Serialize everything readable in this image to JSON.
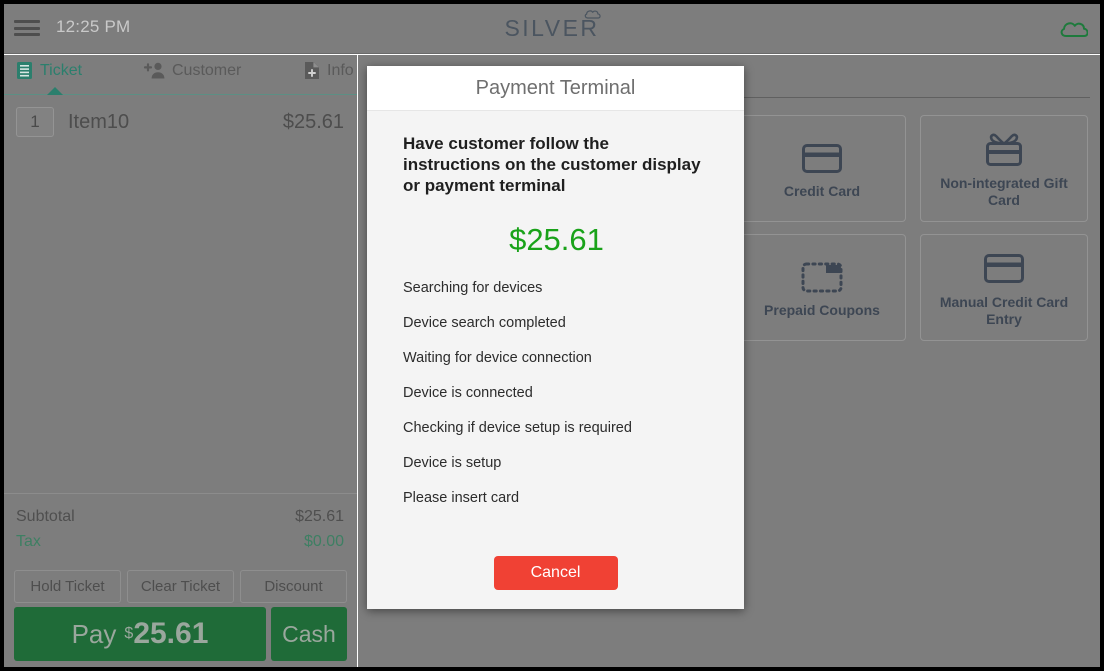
{
  "topbar": {
    "menu_icon": "hamburger-icon",
    "time": "12:25 PM",
    "logo_text": "SILVER",
    "logo_icon": "cloud-icon",
    "status_icon": "cloud-icon"
  },
  "ticket_panel": {
    "tabs": [
      {
        "label": "Ticket",
        "icon": "receipt-icon",
        "active": true
      },
      {
        "label": "Customer",
        "icon": "add-person-icon",
        "active": false
      },
      {
        "label": "Info",
        "icon": "document-add-icon",
        "active": false
      }
    ],
    "items": [
      {
        "qty": "1",
        "name": "Item10",
        "price": "$25.61"
      }
    ],
    "totals": [
      {
        "label": "Subtotal",
        "value": "$25.61",
        "kind": "subtotal"
      },
      {
        "label": "Tax",
        "value": "$0.00",
        "kind": "tax"
      }
    ],
    "actions": [
      {
        "label": "Hold Ticket"
      },
      {
        "label": "Clear Ticket"
      },
      {
        "label": "Discount"
      }
    ],
    "pay": {
      "word": "Pay",
      "currency": "$",
      "amount": "25.61",
      "cash_label": "Cash"
    }
  },
  "payment_tiles": [
    {
      "label": "Credit Card",
      "icon": "credit-card-icon"
    },
    {
      "label": "Non-integrated Gift Card",
      "icon": "gift-card-icon"
    },
    {
      "label": "Prepaid Coupons",
      "icon": "coupon-dashed-icon"
    },
    {
      "label": "Manual Credit Card Entry",
      "icon": "credit-card-icon"
    }
  ],
  "modal": {
    "title": "Payment Terminal",
    "instructions": "Have customer follow the instructions on the customer display or payment terminal",
    "amount": "$25.61",
    "status_lines": [
      "Searching for devices",
      "Device search completed",
      "Waiting for device connection",
      "Device is connected",
      "Checking if device setup is required",
      "Device is setup",
      "Please insert card"
    ],
    "cancel_label": "Cancel"
  },
  "colors": {
    "scrim": "#7d7d7d",
    "brand_green": "#2b7f6d",
    "pay_green": "#1f6b38",
    "amount_green": "#19a219",
    "cancel_red": "#f04134",
    "tile_icon": "#3d4653"
  }
}
